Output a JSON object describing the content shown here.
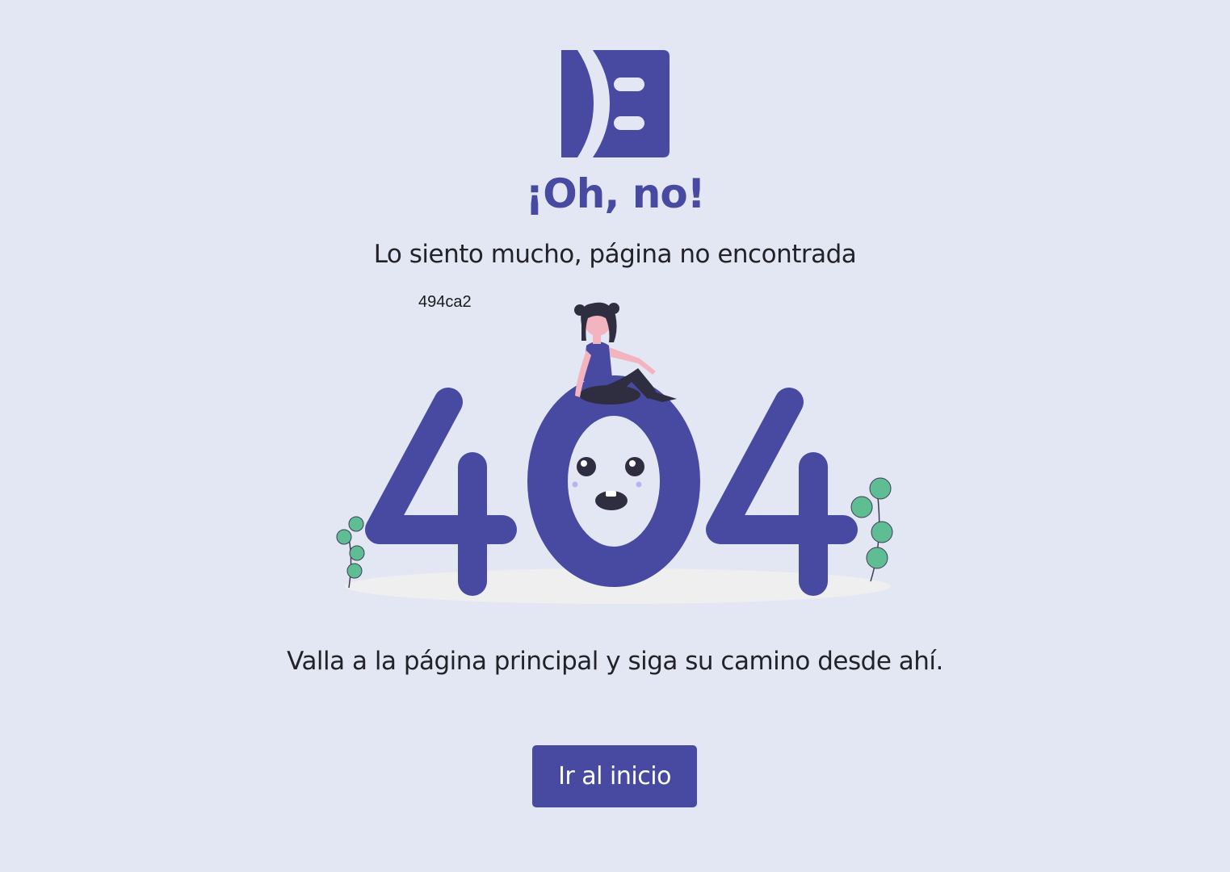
{
  "brand": {
    "logo_icon": "sad-face-logo-icon",
    "accent_color": "#484aa2",
    "background_color": "#e2e7f3"
  },
  "error": {
    "title": "¡Oh, no!",
    "subtitle": "Lo siento mucho, página no encontrada",
    "code_hash": "494ca2",
    "illustration_icon": "404-girl-illustration-icon",
    "illustration_text": "404",
    "message": "Valla a la página principal y siga su camino desde ahí."
  },
  "actions": {
    "home_button_label": "Ir al inicio"
  }
}
